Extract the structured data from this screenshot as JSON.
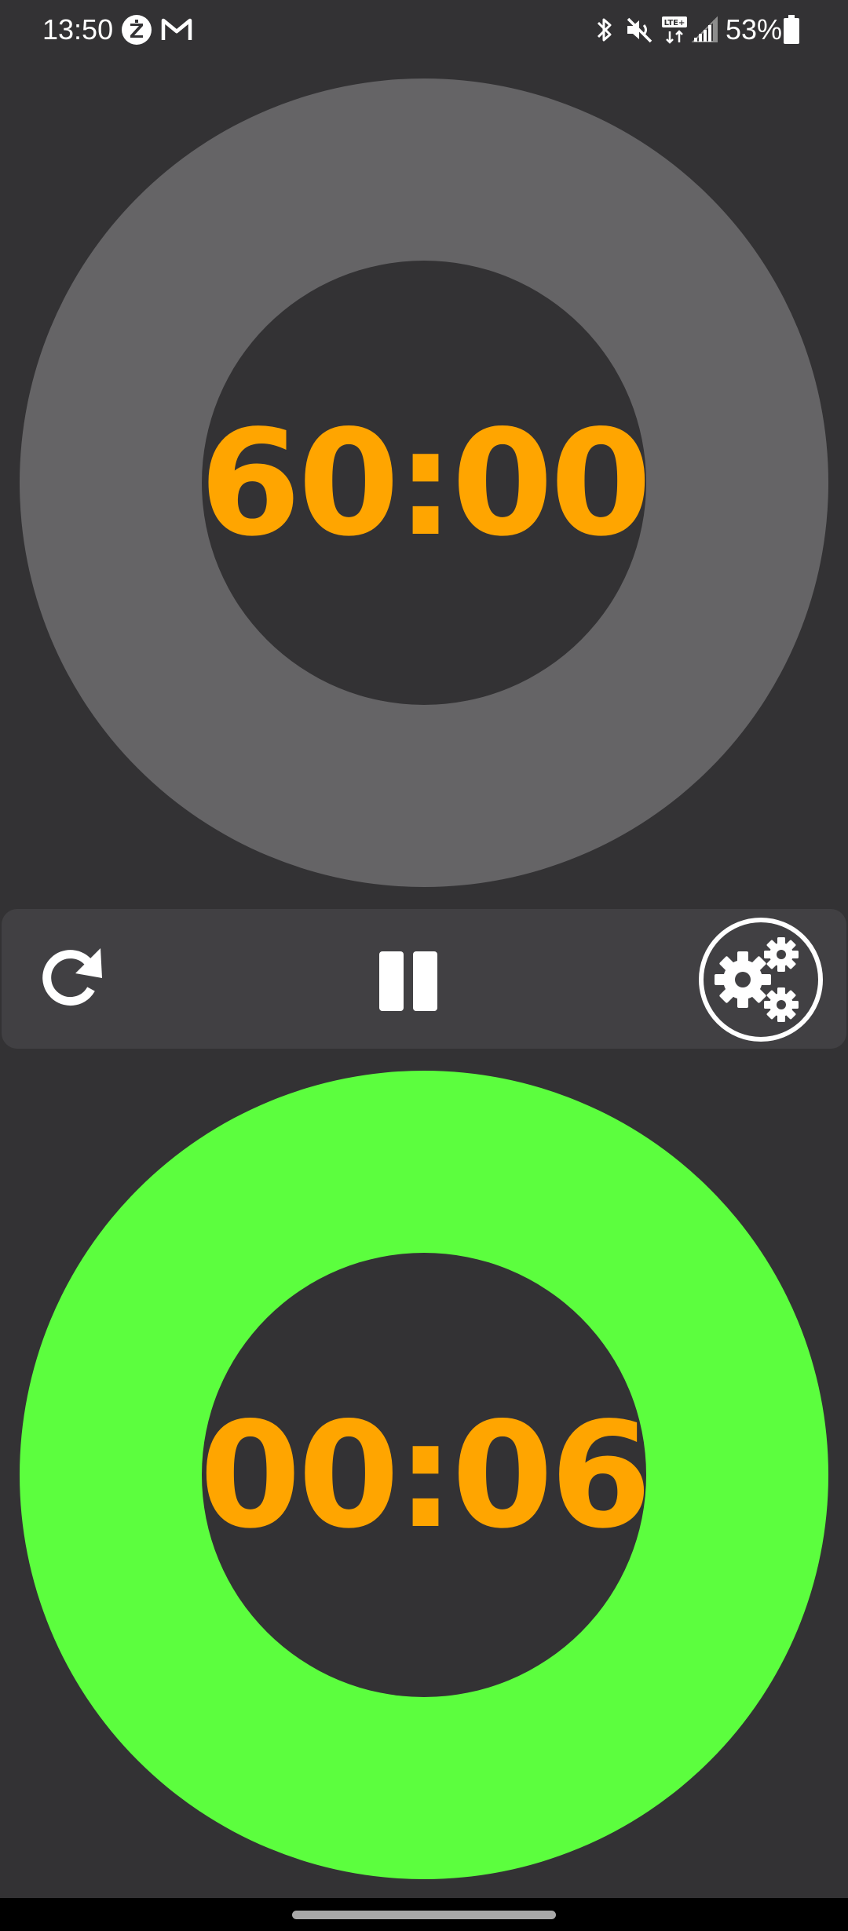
{
  "status_bar": {
    "time": "13:50",
    "battery_percent": "53%",
    "icons": [
      "z-notification-icon",
      "gmail-icon",
      "bluetooth-icon",
      "vibrate-mute-icon",
      "lte-icon",
      "signal-icon",
      "battery-icon"
    ]
  },
  "timers": {
    "top": {
      "time": "60:00",
      "ring_color": "#656466"
    },
    "bottom": {
      "time": "00:06",
      "ring_color": "#5cfe3e"
    },
    "text_color": "#ffa500"
  },
  "controls": {
    "icons": [
      "reset-icon",
      "pause-icon",
      "settings-icon"
    ]
  },
  "colors": {
    "background": "#333234",
    "control_bar": "#414043"
  }
}
